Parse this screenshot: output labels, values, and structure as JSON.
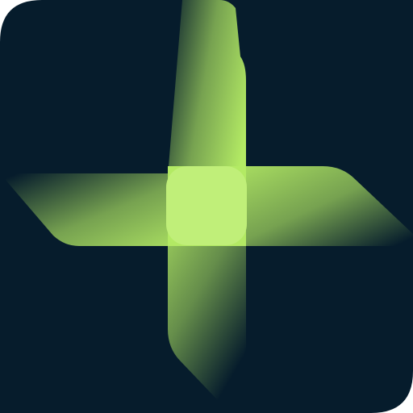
{
  "icon": {
    "semantic": "pinwheel-logo-icon",
    "colors": {
      "background": "#061c2c",
      "accent": "#b3ea64",
      "center": "#c0ef79"
    }
  }
}
